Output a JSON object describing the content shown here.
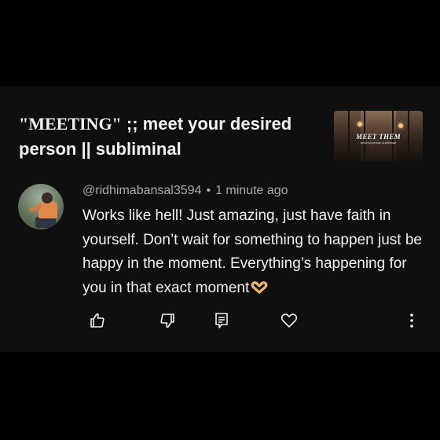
{
  "video": {
    "title_quoted": "\"MEETING\"",
    "title_rest": " ;; meet your desired person || subliminal",
    "thumbnail_text": "MEET THEM",
    "thumbnail_subtext": "desired person subliminal"
  },
  "comment": {
    "author": "@ridhimabansal3594",
    "separator": "•",
    "time": "1 minute ago",
    "text": "Works like hell! Just amazing, just have faith in yourself. Don’t wait for something to happen just be happy in the moment. Everything’s happening for you in that exact moment",
    "emoji": "heart-hands-icon"
  },
  "actions": {
    "like": "thumbs-up-icon",
    "dislike": "thumbs-down-icon",
    "reply": "reply-icon",
    "heart": "heart-icon",
    "more": "more-vertical-icon"
  },
  "colors": {
    "background": "#000000",
    "card": "#0f0f0f",
    "text_primary": "#f1f1f1",
    "text_secondary": "#aaaaaa"
  }
}
